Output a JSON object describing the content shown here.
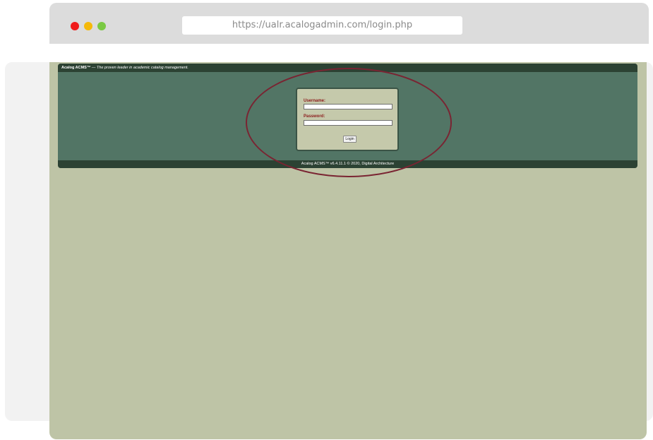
{
  "browser": {
    "url": "https://ualr.acalogadmin.com/login.php",
    "dots": [
      "#f01b1b",
      "#f5b90a",
      "#7ac943"
    ]
  },
  "header": {
    "brand": "Acalog ACMS™",
    "separator": " — ",
    "tagline": "The proven leader in academic catalog management."
  },
  "login": {
    "username_label": "Username:",
    "username_value": "",
    "password_label": "Password:",
    "password_value": "",
    "button_label": "Login"
  },
  "footer": {
    "text": "Acalog ACMS™ v6.4.11.1 © 2020, Digital Architecture"
  },
  "colors": {
    "panel": "#527565",
    "panel_bar": "#2c4233",
    "page_bg": "#bec4a6",
    "label_red": "#8b1a1a",
    "annotation": "#7a2432"
  }
}
